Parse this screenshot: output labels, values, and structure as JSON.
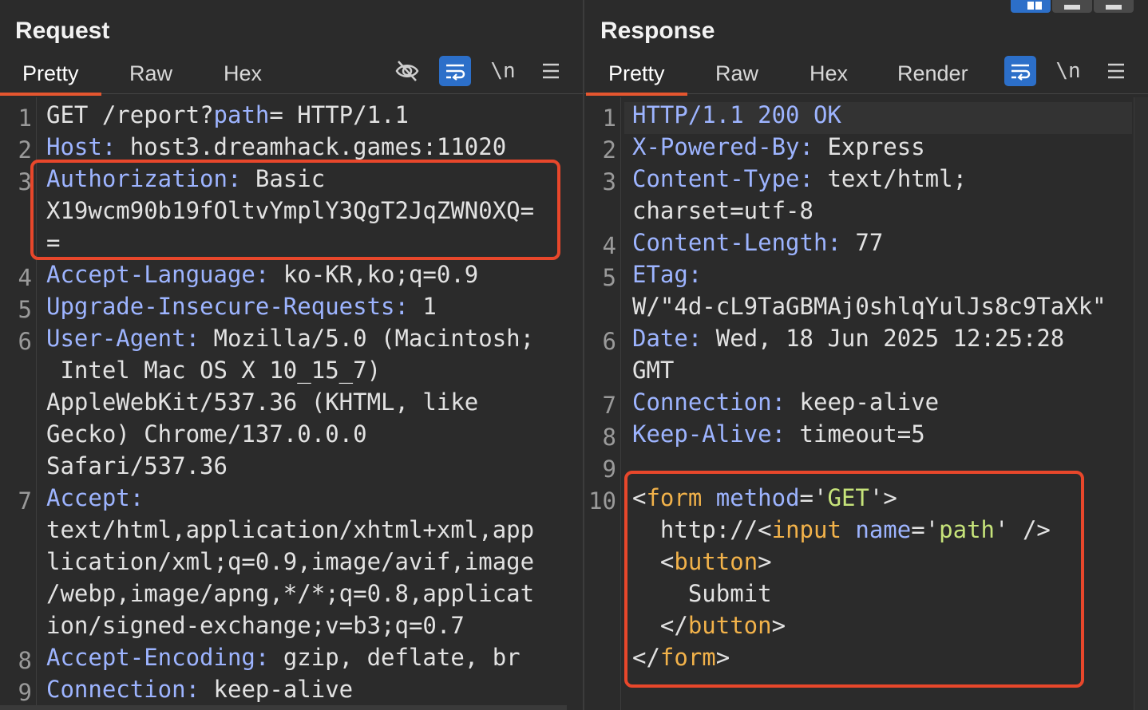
{
  "request": {
    "title": "Request",
    "tabs": [
      "Pretty",
      "Raw",
      "Hex"
    ],
    "active_tab": "Pretty",
    "toolbar_icons": [
      "eye-slash-icon",
      "wrap-icon",
      "newline-icon",
      "menu-icon"
    ],
    "newline_label": "\\n",
    "lines": [
      {
        "n": "1",
        "method": "GET",
        "path_prefix": " /report?",
        "param": "path",
        "path_suffix": "= HTTP/1.1"
      },
      {
        "n": "2",
        "key": "Host:",
        "val": " host3.dreamhack.games:11020"
      },
      {
        "n": "3",
        "key": "Authorization:",
        "val": " Basic",
        "cont": [
          "X19wcm90b19fOltvYmplY3QgT2JqZWN0XQ=",
          "="
        ]
      },
      {
        "n": "4",
        "key": "Accept-Language:",
        "val": " ko-KR,ko;q=0.9"
      },
      {
        "n": "5",
        "key": "Upgrade-Insecure-Requests:",
        "val": " 1"
      },
      {
        "n": "6",
        "key": "User-Agent:",
        "val": " Mozilla/5.0 (Macintosh;",
        "cont": [
          " Intel Mac OS X 10_15_7)",
          "AppleWebKit/537.36 (KHTML, like",
          "Gecko) Chrome/137.0.0.0",
          "Safari/537.36"
        ]
      },
      {
        "n": "7",
        "key": "Accept:",
        "val": "",
        "cont": [
          "text/html,application/xhtml+xml,app",
          "lication/xml;q=0.9,image/avif,image",
          "/webp,image/apng,*/*;q=0.8,applicat",
          "ion/signed-exchange;v=b3;q=0.7"
        ]
      },
      {
        "n": "8",
        "key": "Accept-Encoding:",
        "val": " gzip, deflate, br"
      },
      {
        "n": "9",
        "key": "Connection:",
        "val": " keep-alive"
      }
    ]
  },
  "response": {
    "title": "Response",
    "tabs": [
      "Pretty",
      "Raw",
      "Hex",
      "Render"
    ],
    "active_tab": "Pretty",
    "toolbar_icons": [
      "wrap-icon",
      "newline-icon",
      "menu-icon"
    ],
    "newline_label": "\\n",
    "lines": [
      {
        "n": "1",
        "key": "HTTP/1.1 200 OK",
        "val": ""
      },
      {
        "n": "2",
        "key": "X-Powered-By:",
        "val": " Express"
      },
      {
        "n": "3",
        "key": "Content-Type:",
        "val": " text/html;",
        "cont": [
          "charset=utf-8"
        ]
      },
      {
        "n": "4",
        "key": "Content-Length:",
        "val": " 77"
      },
      {
        "n": "5",
        "key": "ETag:",
        "val": "",
        "cont": [
          "W/\"4d-cL9TaGBMAj0shlqYulJs8c9TaXk\""
        ]
      },
      {
        "n": "6",
        "key": "Date:",
        "val": " Wed, 18 Jun 2025 12:25:28",
        "cont": [
          "GMT"
        ]
      },
      {
        "n": "7",
        "key": "Connection:",
        "val": " keep-alive"
      },
      {
        "n": "8",
        "key": "Keep-Alive:",
        "val": " timeout=5"
      },
      {
        "n": "9",
        "key": "",
        "val": ""
      },
      {
        "n": "10",
        "key": "",
        "val": ""
      }
    ],
    "html_body": {
      "l1": {
        "lt": "<",
        "tag": "form",
        "sp": " ",
        "attr": "method",
        "eq": "=",
        "q1": "'",
        "value": "GET",
        "q2": "'",
        "gt": ">"
      },
      "l2": {
        "text": "  http://",
        "lt": "<",
        "tag": "input",
        "sp": " ",
        "attr": "name",
        "eq": "=",
        "q1": "'",
        "value": "path",
        "q2": "'",
        "end": " />"
      },
      "l3": {
        "ind": "  ",
        "lt": "<",
        "tag": "button",
        "gt": ">"
      },
      "l4": {
        "text": "    Submit"
      },
      "l5": {
        "ind": "  ",
        "lt": "</",
        "tag": "button",
        "gt": ">"
      },
      "l6": {
        "lt": "</",
        "tag": "form",
        "gt": ">"
      }
    }
  },
  "layout_toggle": [
    "split-horizontal-icon",
    "split-vertical-icon",
    "single-pane-icon"
  ]
}
